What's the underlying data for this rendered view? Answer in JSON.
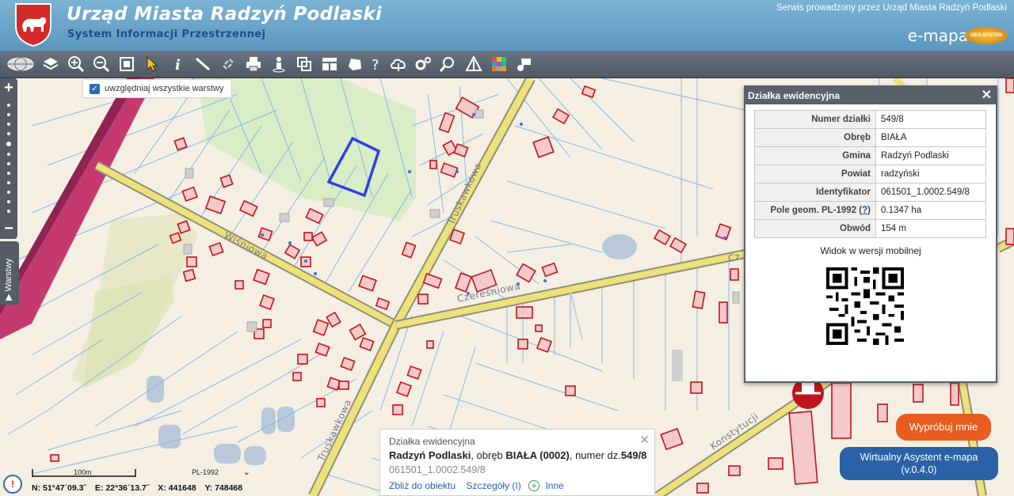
{
  "header": {
    "title": "Urząd Miasta Radzyń Podlaski",
    "subtitle": "System Informacji Przestrzennej",
    "service_note": "Serwis prowadzony przez Urząd Miasta Radzyń Podlaski",
    "brand": "e-mapa",
    "brand_badge": "GEO-SYSTEM"
  },
  "toolbar": {
    "icons": [
      "globe-icon",
      "layers-icon",
      "zoom-in-icon",
      "zoom-out-icon",
      "zoom-extent-icon",
      "pointer-icon",
      "info-icon",
      "measure-icon",
      "link-icon",
      "print-icon",
      "street-view-icon",
      "compare-icon",
      "layout-icon",
      "draw-icon",
      "help-icon",
      "cloud-icon",
      "settings-icon",
      "search-icon",
      "stream-icon",
      "palette-icon",
      "chat-icon"
    ]
  },
  "layers_checkbox": {
    "label": "uwzględniaj wszystkie warstwy",
    "checked": true
  },
  "side": {
    "zoom_in": "+",
    "zoom_out": "−",
    "layers_tab": "▶ Warstwy"
  },
  "map_labels": {
    "wisniowa": "Wiśniowa",
    "czeresniowa": "Czereśniowa",
    "truskawkowa_top": "Truskawkowa",
    "truskawkowa_bottom": "Truskawkowa",
    "konstytucji": "Konstytucji",
    "cz_right": "Cz"
  },
  "panel": {
    "title": "Działka ewidencyjna",
    "close": "✕",
    "rows": [
      {
        "key": "Numer działki",
        "value": "549/8"
      },
      {
        "key": "Obręb",
        "value": "BIAŁA"
      },
      {
        "key": "Gmina",
        "value": "Radzyń Podlaski"
      },
      {
        "key": "Powiat",
        "value": "radzyński"
      },
      {
        "key": "Identyfikator",
        "value": "061501_1.0002.549/8"
      },
      {
        "key": "Pole geom. PL-1992",
        "help": "?",
        "value": "0.1347 ha"
      },
      {
        "key": "Obwód",
        "value": "154 m"
      }
    ],
    "mobile_label": "Widok w wersji mobilnej"
  },
  "popup": {
    "title": "Działka ewidencyjna",
    "close": "✕",
    "place": "Radzyń Podlaski",
    "obreb_prefix": ", obręb ",
    "obreb": "BIAŁA (0002)",
    "number_prefix": ", numer dz.",
    "number": "549/8",
    "identifier": "061501_1.0002.549/8",
    "zoom_link": "Zbliż do obiektu",
    "details_link": "Szczegóły (I)",
    "more_link": "Inne"
  },
  "status": {
    "alert": "!",
    "scale_label": "100m",
    "crs": "PL-1992",
    "coords": {
      "n": "N: 51°47´09.3˝",
      "e": "E: 22°36´13.7˝",
      "x": "X: 441648",
      "y": "Y: 748468"
    }
  },
  "buttons": {
    "try": "Wypróbuj mnie",
    "assistant_line1": "Wirtualny Asystent e-mapa",
    "assistant_line2": "(v.0.4.0)"
  },
  "colors": {
    "header_bg": "#6aa6cc",
    "toolbar_bg": "#5a626d",
    "map_bg": "#f4efe2",
    "road_fill": "#efe27a",
    "building_outline": "#c0141c",
    "parcel_line": "#7fb4ea",
    "selected_parcel": "#2f3fe0",
    "accent_orange": "#e85d1f",
    "accent_blue": "#2a62a8"
  }
}
